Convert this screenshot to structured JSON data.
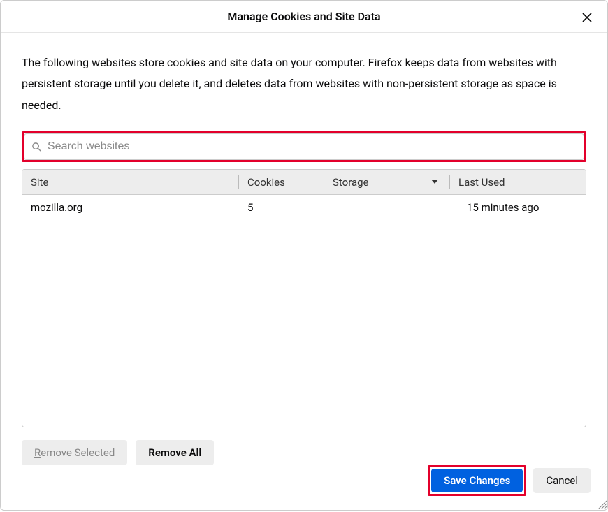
{
  "header": {
    "title": "Manage Cookies and Site Data"
  },
  "description": "The following websites store cookies and site data on your computer. Firefox keeps data from websites with persistent storage until you delete it, and deletes data from websites with non-persistent storage as space is needed.",
  "search": {
    "placeholder": "Search websites",
    "value": ""
  },
  "table": {
    "headers": {
      "site": "Site",
      "cookies": "Cookies",
      "storage": "Storage",
      "last_used": "Last Used"
    },
    "rows": [
      {
        "site": "mozilla.org",
        "cookies": "5",
        "storage": "",
        "last_used": "15 minutes ago"
      }
    ]
  },
  "buttons": {
    "remove_selected_rest": "emove Selected",
    "remove_all_rest": "emove All",
    "save_changes": "Save Changes",
    "cancel": "Cancel"
  }
}
